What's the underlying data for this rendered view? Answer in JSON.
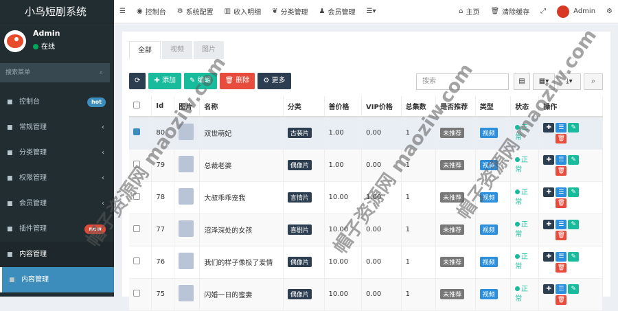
{
  "app": {
    "title": "小鸟短剧系统"
  },
  "user": {
    "name": "Admin",
    "status": "在线"
  },
  "sidebar": {
    "search_placeholder": "搜索菜单",
    "items": [
      {
        "label": "控制台",
        "icon": "dashboard-icon",
        "badge": "hot",
        "badge_color": "#3c8dbc"
      },
      {
        "label": "常规管理",
        "icon": "cogs-icon",
        "arrow": "‹"
      },
      {
        "label": "分类管理",
        "icon": "leaf-icon",
        "arrow": "‹"
      },
      {
        "label": "权限管理",
        "icon": "group-icon",
        "arrow": "‹"
      },
      {
        "label": "会员管理",
        "icon": "list-icon",
        "arrow": "‹"
      },
      {
        "label": "插件管理",
        "icon": "rocket-icon",
        "badge": "new",
        "badge_color": "#dd4b39"
      },
      {
        "label": "内容管理",
        "icon": "file-icon"
      },
      {
        "label": "内容管理",
        "icon": "file-icon"
      }
    ]
  },
  "topbar": {
    "items": [
      "控制台",
      "系统配置",
      "收入明细",
      "分类管理",
      "会员管理"
    ],
    "right": [
      "主页",
      "清除缓存"
    ],
    "admin": "Admin"
  },
  "tabs": [
    "全部",
    "视频",
    "图片"
  ],
  "toolbar": {
    "add": "添加",
    "edit": "编辑",
    "delete": "删除",
    "more": "更多",
    "search_placeholder": "搜索"
  },
  "table": {
    "headers": [
      "",
      "Id",
      "图片",
      "名称",
      "分类",
      "普价格",
      "VIP价格",
      "总集数",
      "是否推荐",
      "类型",
      "状态",
      "操作"
    ],
    "rows": [
      {
        "id": "80",
        "name": "双世萌妃",
        "category": "古装片",
        "price": "1.00",
        "vip": "0.00",
        "episodes": "1",
        "recommend": "未推荐",
        "type": "视频",
        "status": "正常",
        "checked": true
      },
      {
        "id": "79",
        "name": "总裁老婆",
        "category": "偶像片",
        "price": "1.00",
        "vip": "0.00",
        "episodes": "1",
        "recommend": "未推荐",
        "type": "视频",
        "status": "正常",
        "checked": false
      },
      {
        "id": "78",
        "name": "大叔乖乖宠我",
        "category": "言情片",
        "price": "10.00",
        "vip": "1.00",
        "episodes": "1",
        "recommend": "未推荐",
        "type": "视频",
        "status": "正常",
        "checked": false
      },
      {
        "id": "77",
        "name": "沼泽深处的女孩",
        "category": "喜剧片",
        "price": "10.00",
        "vip": "0.00",
        "episodes": "1",
        "recommend": "未推荐",
        "type": "视频",
        "status": "正常",
        "checked": false
      },
      {
        "id": "76",
        "name": "我们的样子像极了爱情",
        "category": "偶像片",
        "price": "10.00",
        "vip": "0.00",
        "episodes": "1",
        "recommend": "未推荐",
        "type": "视频",
        "status": "正常",
        "checked": false
      },
      {
        "id": "75",
        "name": "闪婚一日的蜜妻",
        "category": "偶像片",
        "price": "10.00",
        "vip": "0.00",
        "episodes": "1",
        "recommend": "未推荐",
        "type": "视频",
        "status": "正常",
        "checked": false
      }
    ]
  },
  "watermark": "帽子资源网 maoziw.com"
}
